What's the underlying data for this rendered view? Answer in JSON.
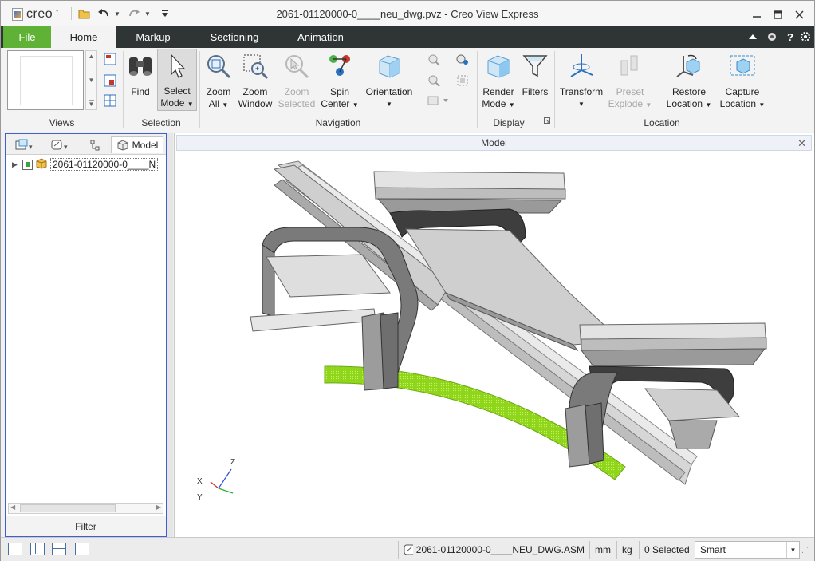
{
  "app": {
    "logo_text": "creo",
    "title": "2061-01120000-0____neu_dwg.pvz - Creo View Express"
  },
  "quick_access": {
    "open": "open-folder-icon",
    "undo": "undo-icon",
    "redo": "redo-icon",
    "customize": "customize-icon"
  },
  "tabs": [
    {
      "label": "File"
    },
    {
      "label": "Home"
    },
    {
      "label": "Markup"
    },
    {
      "label": "Sectioning"
    },
    {
      "label": "Animation"
    }
  ],
  "ribbon": {
    "groups": {
      "views": "Views",
      "selection": "Selection",
      "navigation": "Navigation",
      "display": "Display",
      "location": "Location"
    },
    "buttons": {
      "find": "Find",
      "select_mode_1": "Select",
      "select_mode_2": "Mode",
      "zoom_all_1": "Zoom",
      "zoom_all_2": "All",
      "zoom_window_1": "Zoom",
      "zoom_window_2": "Window",
      "zoom_selected_1": "Zoom",
      "zoom_selected_2": "Selected",
      "spin_center_1": "Spin",
      "spin_center_2": "Center",
      "orientation": "Orientation",
      "render_mode_1": "Render",
      "render_mode_2": "Mode",
      "filters": "Filters",
      "transform": "Transform",
      "preset_explode_1": "Preset",
      "preset_explode_2": "Explode",
      "restore_location_1": "Restore",
      "restore_location_2": "Location",
      "capture_location_1": "Capture",
      "capture_location_2": "Location"
    }
  },
  "left_panel": {
    "tab_model": "Model",
    "tree_root": "2061-01120000-0____N",
    "filter": "Filter"
  },
  "model_pane": {
    "header": "Model",
    "axis_x": "X",
    "axis_y": "Y",
    "axis_z": "Z"
  },
  "status": {
    "file": "2061-01120000-0____NEU_DWG.ASM",
    "unit_length": "mm",
    "unit_mass": "kg",
    "selected": "0 Selected",
    "filter_mode": "Smart"
  },
  "colors": {
    "tab_bar": "#2f3535",
    "file_tab": "#5fb236",
    "highlight_part": "#8fd61a",
    "selection_border": "#3d5fcf"
  }
}
